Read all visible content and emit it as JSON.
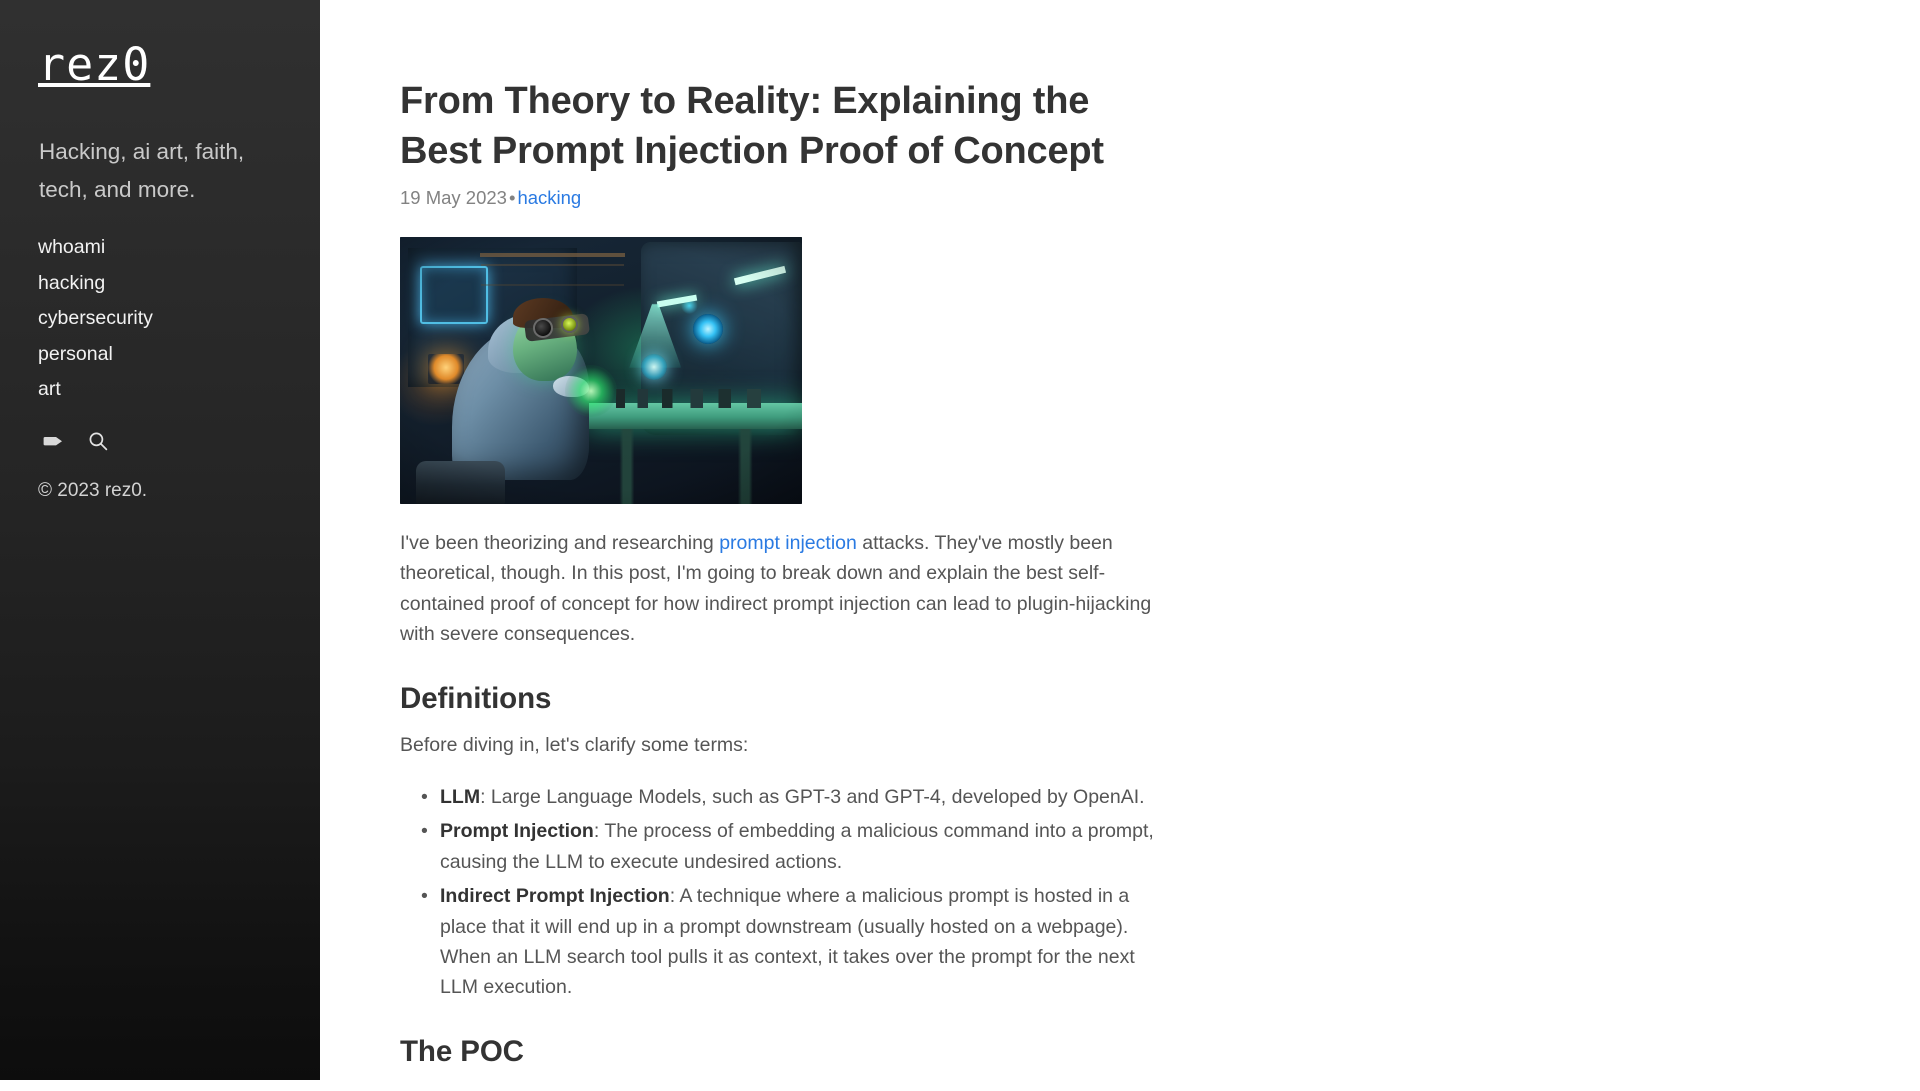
{
  "sidebar": {
    "logo": "rez0",
    "tagline": "Hacking, ai art, faith, tech, and more.",
    "nav": [
      {
        "label": "whoami"
      },
      {
        "label": "hacking"
      },
      {
        "label": "cybersecurity"
      },
      {
        "label": "personal"
      },
      {
        "label": "art"
      }
    ],
    "icons": [
      {
        "name": "tag-icon"
      },
      {
        "name": "search-icon"
      }
    ],
    "copyright": "© 2023 rez0."
  },
  "post": {
    "title": "From Theory to Reality: Explaining the Best Prompt Injection Proof of Concept",
    "date": "19 May 2023",
    "meta_separator": "•",
    "category": "hacking",
    "hero_image_alt": "Hooded figure wearing goggles soldering glowing green circuitry at a workbench beside a cyberpunk robot",
    "intro": {
      "before_link": "I've been theorizing and researching ",
      "link_text": "prompt injection",
      "after_link": " attacks. They've mostly been theoretical, though. In this post, I'm going to break down and explain the best self-contained proof of concept for how indirect prompt injection can lead to plugin-hijacking with severe consequences."
    },
    "sections": [
      {
        "heading": "Definitions",
        "lead": "Before diving in, let's clarify some terms:",
        "items": [
          {
            "term": "LLM",
            "text": ": Large Language Models, such as GPT-3 and GPT-4, developed by OpenAI."
          },
          {
            "term": "Prompt Injection",
            "text": ": The process of embedding a malicious command into a prompt, causing the LLM to execute undesired actions."
          },
          {
            "term": "Indirect Prompt Injection",
            "text": ": A technique where a malicious prompt is hosted in a place that it will end up in a prompt downstream (usually hosted on a webpage). When an LLM search tool pulls it as context, it takes over the prompt for the next LLM execution."
          }
        ]
      },
      {
        "heading": "The POC",
        "lead": "",
        "items": []
      }
    ]
  },
  "colors": {
    "link": "#2a7ae2",
    "heading": "#333333",
    "body_text": "#555555",
    "meta_text": "#828282",
    "sidebar_top": "#303030",
    "sidebar_bottom": "#0d0d0d"
  }
}
